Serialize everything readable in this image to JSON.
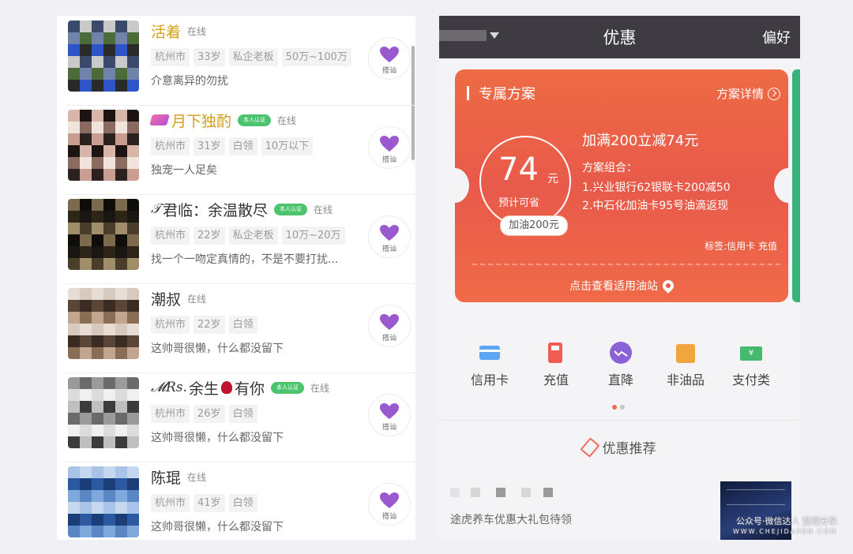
{
  "left": {
    "users": [
      {
        "name": "活着",
        "name_style": "gold",
        "online": "在线",
        "tags": [
          "杭州市",
          "33岁",
          "私企老板",
          "50万~100万"
        ],
        "bio": "介意离异的勿扰",
        "avatar_colors": [
          "#3b4a6b",
          "#6f84a8",
          "#2d55c8",
          "#c9c9c9",
          "#4d6b3a",
          "#2a2a2a"
        ]
      },
      {
        "name": "月下独酌",
        "name_style": "gold",
        "gem": true,
        "verified": "本人认证",
        "online": "在线",
        "tags": [
          "杭州市",
          "31岁",
          "白领",
          "10万以下"
        ],
        "bio": "独宠一人足矣",
        "avatar_colors": [
          "#2b2220",
          "#d7b6a9",
          "#efe3dc",
          "#c99d90",
          "#1c1413",
          "#8b6a60"
        ]
      },
      {
        "name": "君临：余温散尽",
        "prefix": "𝒯",
        "verified": "本人认证",
        "online": "在线",
        "tags": [
          "杭州市",
          "22岁",
          "私企老板",
          "10万~20万"
        ],
        "bio": "找一个一吻定真情的，不是不要打扰...",
        "avatar_colors": [
          "#1a1712",
          "#4a3d2a",
          "#7b6a4e",
          "#2c2518",
          "#a08d6a",
          "#0f0d0a"
        ]
      },
      {
        "name": "潮叔",
        "online": "在线",
        "tags": [
          "杭州市",
          "22岁",
          "白领"
        ],
        "bio": "这帅哥很懒，什么都没留下",
        "avatar_colors": [
          "#d8c9bf",
          "#3a2c23",
          "#8a6d55",
          "#e8ddd5",
          "#5a4536",
          "#c3a48d"
        ]
      },
      {
        "name": "余生",
        "prefix": "𝓜Rs.",
        "suffix": "有你",
        "rose": true,
        "verified": "本人认证",
        "online": "在线",
        "tags": [
          "杭州市",
          "26岁",
          "白领"
        ],
        "bio": "这帅哥很懒，什么都没留下",
        "avatar_colors": [
          "#bfbfbf",
          "#6a6a6a",
          "#f0f0f0",
          "#3c3c3c",
          "#9a9a9a",
          "#dcdcdc"
        ]
      },
      {
        "name": "陈琨",
        "online": "在线",
        "tags": [
          "杭州市",
          "41岁",
          "白领"
        ],
        "bio": "这帅哥很懒，什么都没留下",
        "avatar_colors": [
          "#2c5aa0",
          "#7fa8dc",
          "#c5d8f0",
          "#1b3e78",
          "#5b86c4",
          "#a9c3e8"
        ]
      }
    ],
    "greet_label": "搭讪",
    "colors": {
      "heart": "#9b59d0",
      "gold": "#d4a017",
      "verify": "#4cc46e"
    }
  },
  "right": {
    "nav": {
      "title": "优惠",
      "preference": "偏好"
    },
    "card": {
      "title": "专属方案",
      "detail": "方案详情",
      "amount": "74",
      "unit": "元",
      "estimate": "预计可省",
      "pill": "加油200元",
      "promo": "加满200立减74元",
      "plan_heading": "方案组合：",
      "plans": [
        "1.兴业银行62银联卡200减50",
        "2.中石化加油卡95号油滴返现"
      ],
      "tag_line": "标签:信用卡 充值",
      "footer": "点击查看适用油站"
    },
    "categories": [
      {
        "label": "信用卡",
        "icon": "credit-card-icon"
      },
      {
        "label": "充值",
        "icon": "fuel-pump-icon"
      },
      {
        "label": "直降",
        "icon": "price-drop-icon"
      },
      {
        "label": "非油品",
        "icon": "shopping-bag-icon"
      },
      {
        "label": "支付类",
        "icon": "payment-ticket-icon"
      }
    ],
    "pager_colors": [
      "#ef6b4f",
      "#c8c8c8"
    ],
    "recommend": "优惠推荐",
    "bottom_text": "途虎养车优惠大礼包待领",
    "watermark": "公众号·微信达人 整理分享",
    "watermark_sub": "WWW.CHEJIDAREN.COM",
    "ticket_glyph": "¥"
  }
}
